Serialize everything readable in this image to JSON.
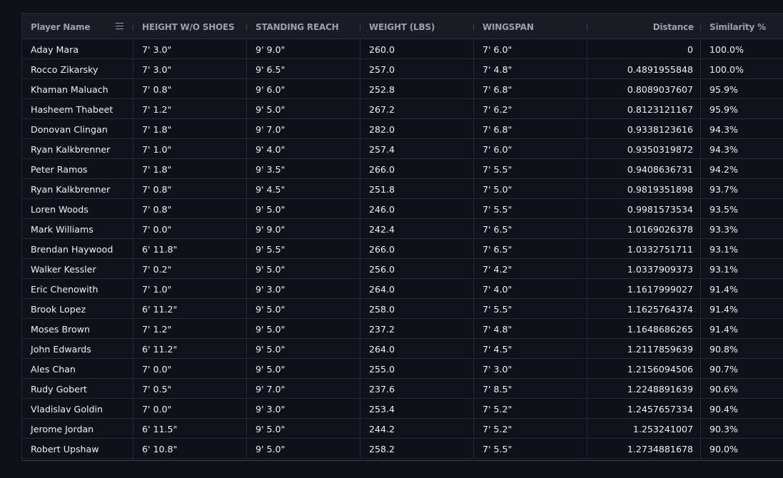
{
  "table": {
    "columns": [
      {
        "label": "Player Name",
        "align": "left"
      },
      {
        "label": "HEIGHT W/O SHOES",
        "align": "left"
      },
      {
        "label": "STANDING REACH",
        "align": "left"
      },
      {
        "label": "WEIGHT (LBS)",
        "align": "left"
      },
      {
        "label": "WINGSPAN",
        "align": "left"
      },
      {
        "label": "Distance",
        "align": "right"
      },
      {
        "label": "Similarity %",
        "align": "left"
      }
    ],
    "rows": [
      [
        "Aday Mara",
        "7' 3.0\"",
        "9' 9.0\"",
        "260.0",
        "7' 6.0\"",
        "0",
        "100.0%"
      ],
      [
        "Rocco Zikarsky",
        "7' 3.0\"",
        "9' 6.5\"",
        "257.0",
        "7' 4.8\"",
        "0.4891955848",
        "100.0%"
      ],
      [
        "Khaman Maluach",
        "7' 0.8\"",
        "9' 6.0\"",
        "252.8",
        "7' 6.8\"",
        "0.8089037607",
        "95.9%"
      ],
      [
        "Hasheem Thabeet",
        "7' 1.2\"",
        "9' 5.0\"",
        "267.2",
        "7' 6.2\"",
        "0.8123121167",
        "95.9%"
      ],
      [
        "Donovan Clingan",
        "7' 1.8\"",
        "9' 7.0\"",
        "282.0",
        "7' 6.8\"",
        "0.9338123616",
        "94.3%"
      ],
      [
        "Ryan Kalkbrenner",
        "7' 1.0\"",
        "9' 4.0\"",
        "257.4",
        "7' 6.0\"",
        "0.9350319872",
        "94.3%"
      ],
      [
        "Peter Ramos",
        "7' 1.8\"",
        "9' 3.5\"",
        "266.0",
        "7' 5.5\"",
        "0.9408636731",
        "94.2%"
      ],
      [
        "Ryan Kalkbrenner",
        "7' 0.8\"",
        "9' 4.5\"",
        "251.8",
        "7' 5.0\"",
        "0.9819351898",
        "93.7%"
      ],
      [
        "Loren Woods",
        "7' 0.8\"",
        "9' 5.0\"",
        "246.0",
        "7' 5.5\"",
        "0.9981573534",
        "93.5%"
      ],
      [
        "Mark Williams",
        "7' 0.0\"",
        "9' 9.0\"",
        "242.4",
        "7' 6.5\"",
        "1.0169026378",
        "93.3%"
      ],
      [
        "Brendan Haywood",
        "6' 11.8\"",
        "9' 5.5\"",
        "266.0",
        "7' 6.5\"",
        "1.0332751711",
        "93.1%"
      ],
      [
        "Walker Kessler",
        "7' 0.2\"",
        "9' 5.0\"",
        "256.0",
        "7' 4.2\"",
        "1.0337909373",
        "93.1%"
      ],
      [
        "Eric Chenowith",
        "7' 1.0\"",
        "9' 3.0\"",
        "264.0",
        "7' 4.0\"",
        "1.1617999027",
        "91.4%"
      ],
      [
        "Brook Lopez",
        "6' 11.2\"",
        "9' 5.0\"",
        "258.0",
        "7' 5.5\"",
        "1.1625764374",
        "91.4%"
      ],
      [
        "Moses Brown",
        "7' 1.2\"",
        "9' 5.0\"",
        "237.2",
        "7' 4.8\"",
        "1.1648686265",
        "91.4%"
      ],
      [
        "John Edwards",
        "6' 11.2\"",
        "9' 5.0\"",
        "264.0",
        "7' 4.5\"",
        "1.2117859639",
        "90.8%"
      ],
      [
        "Ales Chan",
        "7' 0.0\"",
        "9' 5.0\"",
        "255.0",
        "7' 3.0\"",
        "1.2156094506",
        "90.7%"
      ],
      [
        "Rudy Gobert",
        "7' 0.5\"",
        "9' 7.0\"",
        "237.6",
        "7' 8.5\"",
        "1.2248891639",
        "90.6%"
      ],
      [
        "Vladislav Goldin",
        "7' 0.0\"",
        "9' 3.0\"",
        "253.4",
        "7' 5.2\"",
        "1.2457657334",
        "90.4%"
      ],
      [
        "Jerome Jordan",
        "6' 11.5\"",
        "9' 5.0\"",
        "244.2",
        "7' 5.2\"",
        "1.253241007",
        "90.3%"
      ],
      [
        "Robert Upshaw",
        "6' 10.8\"",
        "9' 5.0\"",
        "258.2",
        "7' 5.5\"",
        "1.2734881678",
        "90.0%"
      ]
    ]
  }
}
